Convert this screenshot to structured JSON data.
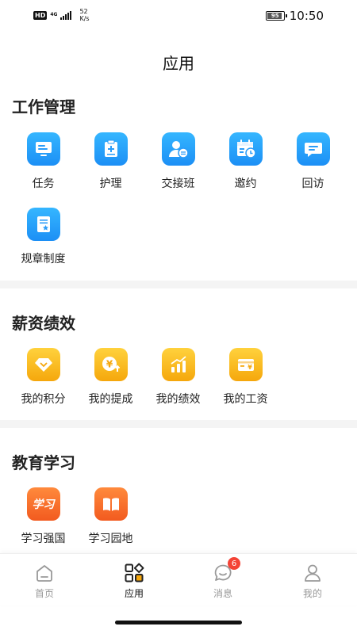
{
  "status_bar": {
    "hd": "HD",
    "network": "4G",
    "speed_value": "52",
    "speed_unit": "K/s",
    "battery": "95",
    "battery_level": 0.95,
    "time": "10:50"
  },
  "page": {
    "title": "应用"
  },
  "sections": [
    {
      "title": "工作管理",
      "items": [
        {
          "label": "任务",
          "icon": "monitor-icon",
          "color": "#1c8ff5"
        },
        {
          "label": "护理",
          "icon": "clipboard-plus-icon",
          "color": "#1c8ff5"
        },
        {
          "label": "交接班",
          "icon": "user-transfer-icon",
          "color": "#1c8ff5"
        },
        {
          "label": "邀约",
          "icon": "calendar-clock-icon",
          "color": "#1c8ff5"
        },
        {
          "label": "回访",
          "icon": "chat-icon",
          "color": "#1c8ff5"
        },
        {
          "label": "规章制度",
          "icon": "document-star-icon",
          "color": "#1c8ff5"
        }
      ]
    },
    {
      "title": "薪资绩效",
      "items": [
        {
          "label": "我的积分",
          "icon": "diamond-icon",
          "color": "#f5a70c"
        },
        {
          "label": "我的提成",
          "icon": "yuan-coin-icon",
          "color": "#f5a70c"
        },
        {
          "label": "我的绩效",
          "icon": "bar-chart-icon",
          "color": "#f5a70c"
        },
        {
          "label": "我的工资",
          "icon": "wallet-card-icon",
          "color": "#f5a70c"
        }
      ]
    },
    {
      "title": "教育学习",
      "items": [
        {
          "label": "学习强国",
          "icon": "xuexi-logo-icon",
          "logo_text": "学习",
          "color": "#f25a1f"
        },
        {
          "label": "学习园地",
          "icon": "open-book-icon",
          "color": "#f25a1f"
        }
      ]
    }
  ],
  "tab_bar": {
    "tabs": [
      {
        "label": "首页",
        "icon": "home-icon",
        "active": false
      },
      {
        "label": "应用",
        "icon": "apps-grid-icon",
        "active": true
      },
      {
        "label": "消息",
        "icon": "message-bubble-icon",
        "active": false,
        "badge": "6"
      },
      {
        "label": "我的",
        "icon": "person-icon",
        "active": false
      }
    ]
  }
}
